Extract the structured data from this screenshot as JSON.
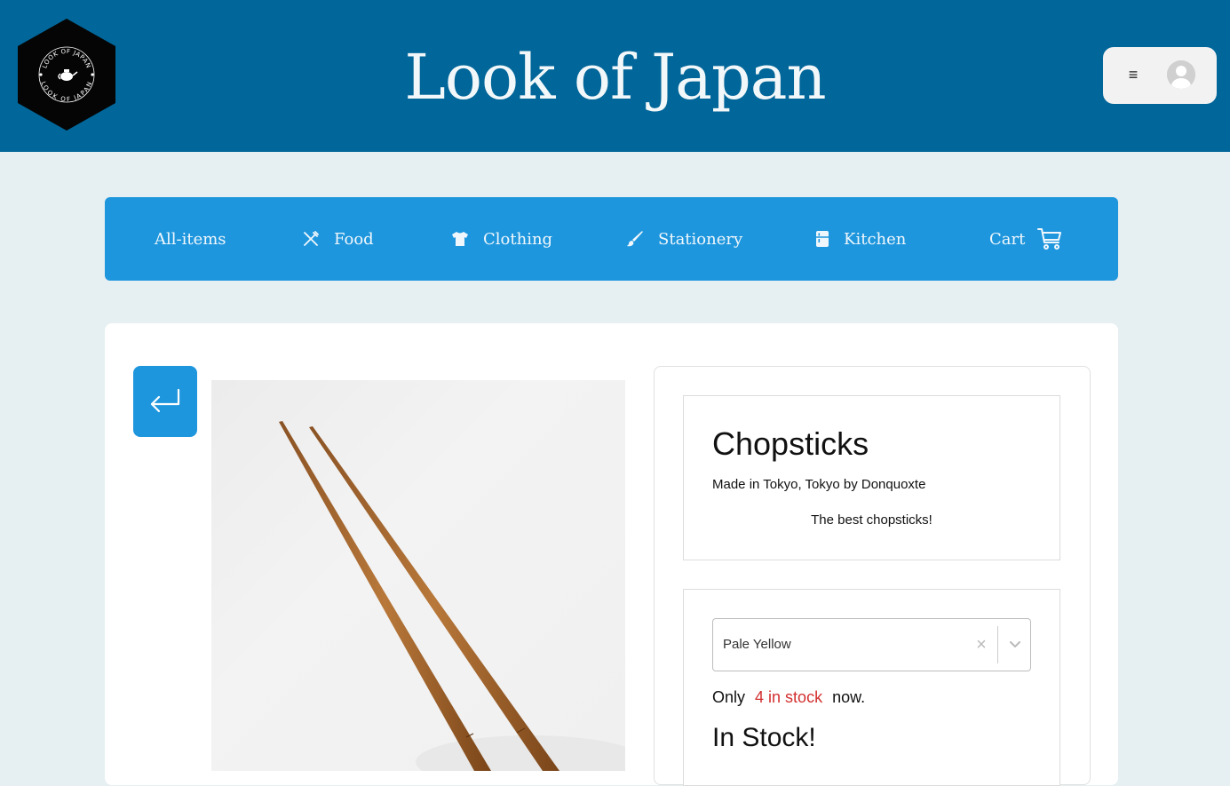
{
  "header": {
    "site_title": "Look of Japan",
    "logo_text_top": "LOOK OF JAPAN",
    "logo_text_bottom": "LOOK OF JAPAN",
    "menu_icon": "hamburger-icon",
    "avatar_icon": "user-avatar-icon",
    "background_color": "#016699"
  },
  "nav": {
    "background_color": "#1e96dd",
    "items": [
      {
        "label": "All-items",
        "icon": ""
      },
      {
        "label": "Food",
        "icon": "utensils-icon"
      },
      {
        "label": "Clothing",
        "icon": "shirt-icon"
      },
      {
        "label": "Stationery",
        "icon": "brush-icon"
      },
      {
        "label": "Kitchen",
        "icon": "fridge-icon"
      },
      {
        "label": "Cart",
        "icon": "cart-icon"
      }
    ]
  },
  "product": {
    "back_icon": "return-arrow-icon",
    "name": "Chopsticks",
    "made_in": "Made in Tokyo, Tokyo by Donquoxte",
    "tagline": "The best chopsticks!",
    "color_select": {
      "value": "Pale Yellow",
      "clear_icon": "close-icon",
      "dropdown_icon": "chevron-down-icon"
    },
    "stock": {
      "prefix": "Only",
      "count_text": "4 in stock",
      "suffix": "now.",
      "count_color": "#d32f2f"
    },
    "availability": "In Stock!"
  }
}
